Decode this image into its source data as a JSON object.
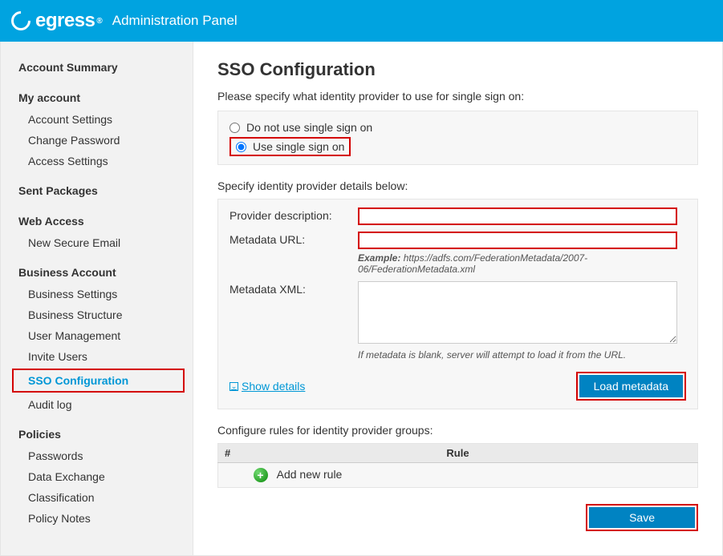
{
  "header": {
    "brand": "egress",
    "brand_reg": "®",
    "panel_title": "Administration Panel"
  },
  "sidebar": {
    "sections": [
      {
        "title": "Account Summary",
        "items": []
      },
      {
        "title": "My account",
        "items": [
          "Account Settings",
          "Change Password",
          "Access Settings"
        ]
      },
      {
        "title": "Sent Packages",
        "items": []
      },
      {
        "title": "Web Access",
        "items": [
          "New Secure Email"
        ]
      },
      {
        "title": "Business Account",
        "items": [
          "Business Settings",
          "Business Structure",
          "User Management",
          "Invite Users",
          "SSO Configuration",
          "Audit log"
        ]
      },
      {
        "title": "Policies",
        "items": [
          "Passwords",
          "Data Exchange",
          "Classification",
          "Policy Notes"
        ]
      }
    ],
    "active_item": "SSO Configuration"
  },
  "main": {
    "title": "SSO Configuration",
    "intro": "Please specify what identity provider to use for single sign on:",
    "radio_no_sso": "Do not use single sign on",
    "radio_use_sso": "Use single sign on",
    "details_heading": "Specify identity provider details below:",
    "label_provider_desc": "Provider description:",
    "label_metadata_url": "Metadata URL:",
    "example_prefix": "Example:",
    "example_url": "https://adfs.com/FederationMetadata/2007-06/FederationMetadata.xml",
    "label_metadata_xml": "Metadata XML:",
    "metadata_note": "If metadata is blank, server will attempt to load it from the URL.",
    "show_details_label": "Show details",
    "load_metadata_button": "Load metadata",
    "rules_intro": "Configure rules for identity provider groups:",
    "rules_table": {
      "col_hash": "#",
      "col_rule": "Rule",
      "add_new_rule": "Add new rule"
    },
    "save_button": "Save"
  },
  "form_values": {
    "provider_description": "",
    "metadata_url": "",
    "metadata_xml": ""
  },
  "colors": {
    "accent": "#00a3e0",
    "link": "#0097d6",
    "highlight_border": "#d40000"
  }
}
